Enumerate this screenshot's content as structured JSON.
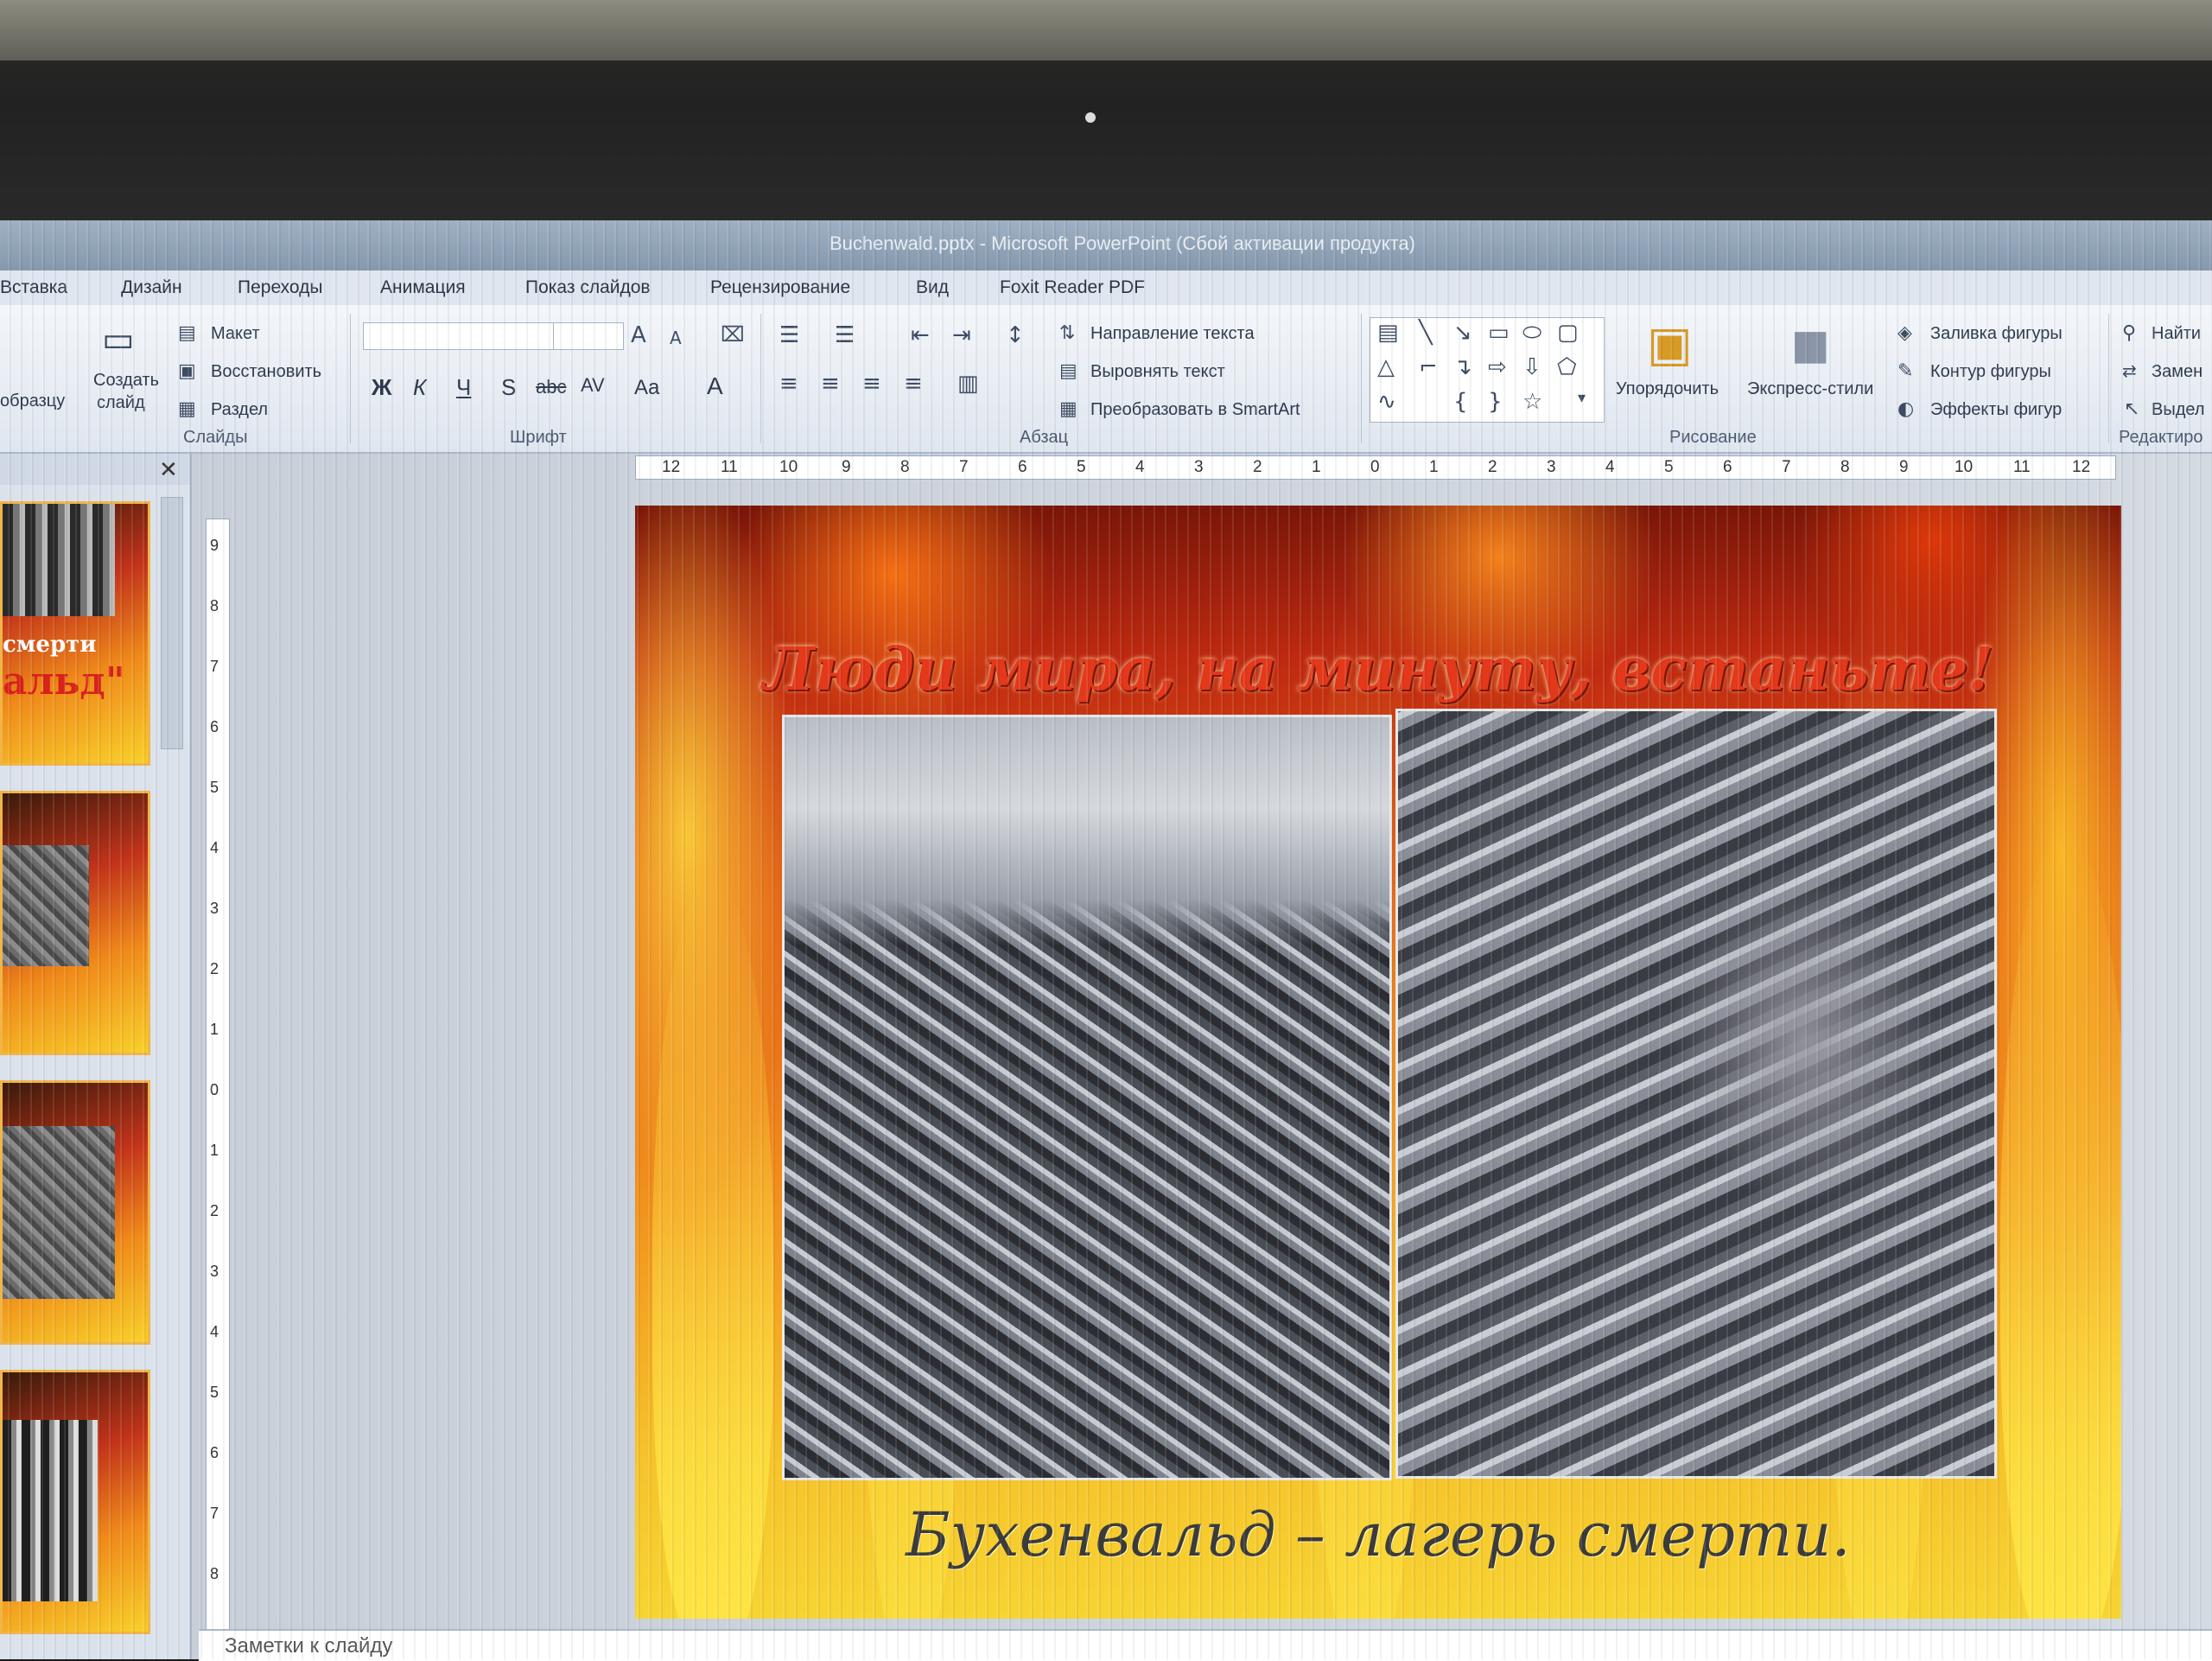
{
  "window": {
    "title": "Buchenwald.pptx - Microsoft PowerPoint (Сбой активации продукта)"
  },
  "tabs": [
    "Вставка",
    "Дизайн",
    "Переходы",
    "Анимация",
    "Показ слайдов",
    "Рецензирование",
    "Вид",
    "Foxit Reader PDF"
  ],
  "ribbon": {
    "slides_group": {
      "label": "Слайды",
      "partial_label": "образцу",
      "new_slide": "Создать",
      "new_slide_sub": "слайд",
      "layout": "Макет",
      "reset": "Восстановить",
      "section": "Раздел"
    },
    "font_group": {
      "label": "Шрифт",
      "bold": "Ж",
      "italic": "К",
      "underline": "Ч",
      "shadow": "S",
      "strike": "abc",
      "spacing": "AV",
      "case": "Aa",
      "color": "A"
    },
    "paragraph_group": {
      "label": "Абзац",
      "text_direction": "Направление текста",
      "align_text": "Выровнять текст",
      "smartart": "Преобразовать в SmartArt"
    },
    "drawing_group": {
      "label": "Рисование",
      "arrange": "Упорядочить",
      "quick_styles": "Экспресс-стили",
      "fill": "Заливка фигуры",
      "outline": "Контур фигуры",
      "effects": "Эффекты фигур"
    },
    "editing_group": {
      "label": "Редактиро",
      "find": "Найти",
      "replace": "Замен",
      "select": "Выдел"
    }
  },
  "thumbnails": [
    {
      "caption_line1": "смерти",
      "caption_line2": "альд\""
    },
    {
      "caption_line1": ""
    },
    {
      "caption_line1": ""
    },
    {
      "caption_line1": ""
    }
  ],
  "rulers": {
    "horizontal": [
      "12",
      "11",
      "10",
      "9",
      "8",
      "7",
      "6",
      "5",
      "4",
      "3",
      "2",
      "1",
      "0",
      "1",
      "2",
      "3",
      "4",
      "5",
      "6",
      "7",
      "8",
      "9",
      "10",
      "11",
      "12"
    ],
    "vertical": [
      "9",
      "8",
      "7",
      "6",
      "5",
      "4",
      "3",
      "2",
      "1",
      "0",
      "1",
      "2",
      "3",
      "4",
      "5",
      "6",
      "7",
      "8"
    ]
  },
  "slide": {
    "title": "Люди мира, на минуту, встаньте!",
    "footer": "Бухенвальд – лагерь смерти."
  },
  "notes": {
    "placeholder": "Заметки к слайду"
  },
  "colors": {
    "title_red": "#e3381a",
    "ribbon_bg": "#dfe6ef",
    "thumb_border": "#f0b54a"
  }
}
